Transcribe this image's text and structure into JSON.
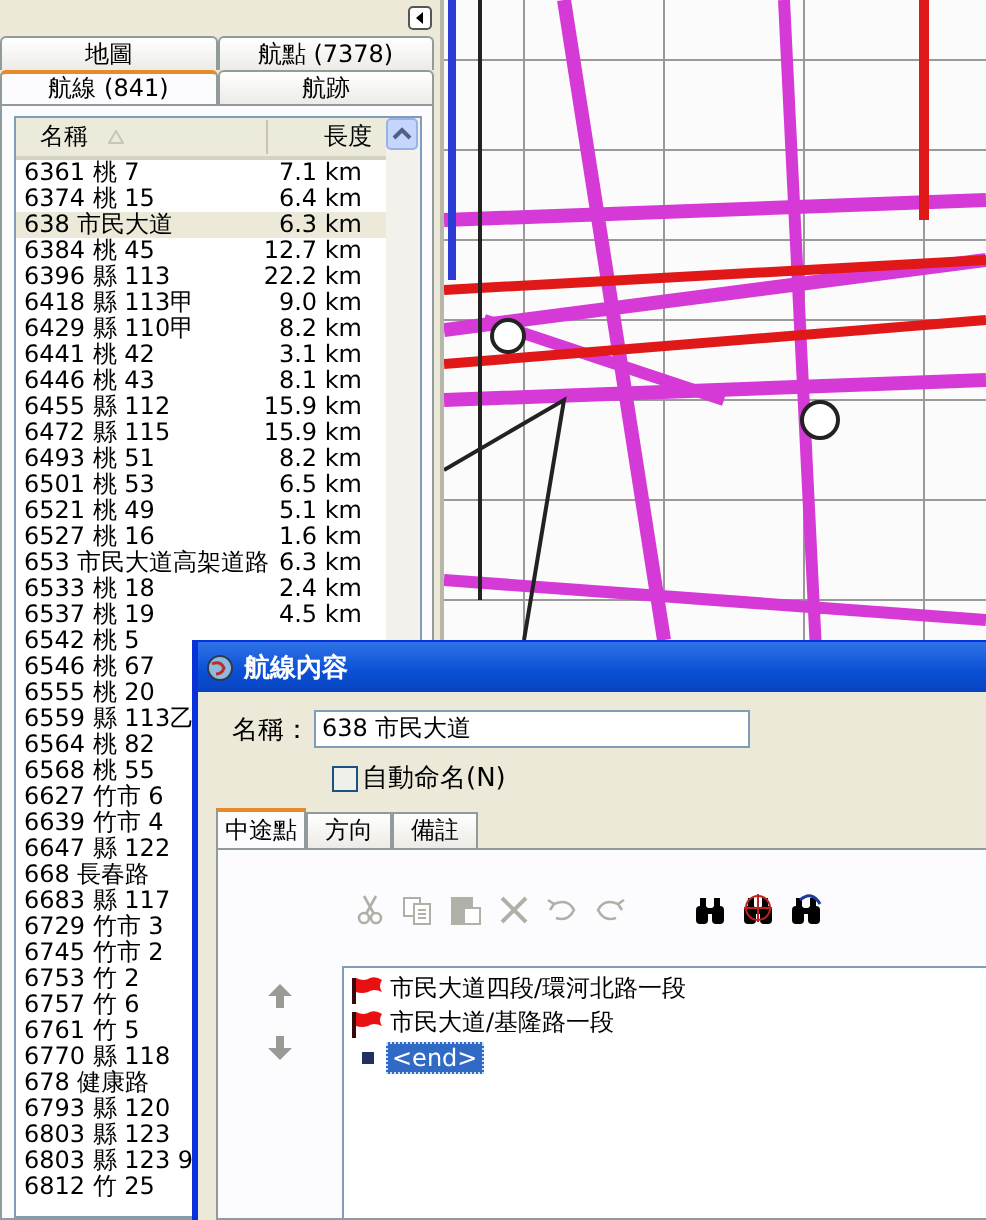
{
  "side_panel": {
    "tab_rows": [
      [
        {
          "label": "地圖",
          "selected": false
        },
        {
          "label": "航點 (7378)",
          "selected": false
        }
      ],
      [
        {
          "label": "航線 (841)",
          "selected": true
        },
        {
          "label": "航跡",
          "selected": false
        }
      ]
    ],
    "list": {
      "columns": [
        "名稱",
        "長度"
      ],
      "rows": [
        {
          "name": "6361 桃 7",
          "length": "7.1 km",
          "selected": false
        },
        {
          "name": "6374 桃 15",
          "length": "6.4 km",
          "selected": false
        },
        {
          "name": "638 市民大道",
          "length": "6.3 km",
          "selected": true
        },
        {
          "name": "6384 桃 45",
          "length": "12.7 km",
          "selected": false
        },
        {
          "name": "6396 縣 113",
          "length": "22.2 km",
          "selected": false
        },
        {
          "name": "6418 縣 113甲",
          "length": "9.0 km",
          "selected": false
        },
        {
          "name": "6429 縣 110甲",
          "length": "8.2 km",
          "selected": false
        },
        {
          "name": "6441 桃 42",
          "length": "3.1 km",
          "selected": false
        },
        {
          "name": "6446 桃 43",
          "length": "8.1 km",
          "selected": false
        },
        {
          "name": "6455 縣 112",
          "length": "15.9 km",
          "selected": false
        },
        {
          "name": "6472 縣 115",
          "length": "15.9 km",
          "selected": false
        },
        {
          "name": "6493 桃 51",
          "length": "8.2 km",
          "selected": false
        },
        {
          "name": "6501 桃 53",
          "length": "6.5 km",
          "selected": false
        },
        {
          "name": "6521 桃 49",
          "length": "5.1 km",
          "selected": false
        },
        {
          "name": "6527 桃 16",
          "length": "1.6 km",
          "selected": false
        },
        {
          "name": "653 市民大道高架道路",
          "length": "6.3 km",
          "selected": false
        },
        {
          "name": "6533 桃 18",
          "length": "2.4 km",
          "selected": false
        },
        {
          "name": "6537 桃 19",
          "length": "4.5 km",
          "selected": false
        },
        {
          "name": "6542 桃 5",
          "selected": false
        },
        {
          "name": "6546 桃 67",
          "selected": false
        },
        {
          "name": "6555 桃 20",
          "selected": false
        },
        {
          "name": "6559 縣 113乙",
          "selected": false
        },
        {
          "name": "6564 桃 82",
          "selected": false
        },
        {
          "name": "6568 桃 55",
          "selected": false
        },
        {
          "name": "6627 竹市 6",
          "selected": false
        },
        {
          "name": "6639 竹市 4",
          "selected": false
        },
        {
          "name": "6647 縣 122",
          "selected": false
        },
        {
          "name": "668 長春路",
          "selected": false
        },
        {
          "name": "6683 縣 117",
          "selected": false
        },
        {
          "name": "6729 竹市 3",
          "selected": false
        },
        {
          "name": "6745 竹市 2",
          "selected": false
        },
        {
          "name": "6753 竹 2",
          "selected": false
        },
        {
          "name": "6757 竹 6",
          "selected": false
        },
        {
          "name": "6761 竹 5",
          "selected": false
        },
        {
          "name": "6770 縣 118",
          "selected": false
        },
        {
          "name": "678 健康路",
          "selected": false
        },
        {
          "name": "6793 縣 120",
          "selected": false
        },
        {
          "name": "6803 縣 123",
          "selected": false
        },
        {
          "name": "6803 縣 123 9",
          "selected": false
        },
        {
          "name": "6812 竹 25",
          "selected": false
        }
      ]
    }
  },
  "dialog": {
    "title": "航線內容",
    "name_label": "名稱：",
    "name_value": "638 市民大道",
    "auto_name": {
      "label": "自動命名(N)",
      "checked": false
    },
    "tabs": [
      {
        "label": "中途點",
        "selected": true
      },
      {
        "label": "方向",
        "selected": false
      },
      {
        "label": "備註",
        "selected": false
      }
    ],
    "toolbar": [
      {
        "kind": "cut",
        "disabled": true
      },
      {
        "kind": "copy",
        "disabled": true
      },
      {
        "kind": "paste",
        "disabled": true
      },
      {
        "kind": "delete",
        "disabled": true
      },
      {
        "kind": "undo",
        "disabled": true
      },
      {
        "kind": "redo",
        "disabled": true
      },
      {
        "kind": "find",
        "disabled": false
      },
      {
        "kind": "find-target",
        "disabled": false
      },
      {
        "kind": "find-next",
        "disabled": false
      }
    ],
    "waypoints": [
      {
        "kind": "flag",
        "label": "市民大道四段/環河北路一段",
        "selected": false
      },
      {
        "kind": "flag",
        "label": "市民大道/基隆路一段",
        "selected": false
      },
      {
        "kind": "end",
        "label": "<end>",
        "selected": true
      }
    ]
  }
}
